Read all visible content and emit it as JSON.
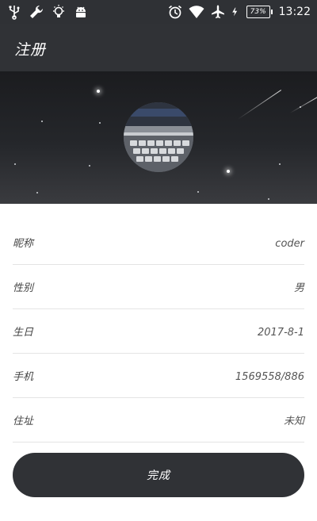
{
  "status_bar": {
    "icons_left": [
      "usb-icon",
      "wrench-icon",
      "lightbulb-icon",
      "android-icon"
    ],
    "icons_right": [
      "alarm-icon",
      "wifi-icon",
      "airplane-icon",
      "charging-icon"
    ],
    "battery": "73%",
    "time": "13:22"
  },
  "header": {
    "title": "注册"
  },
  "form": {
    "rows": [
      {
        "label": "昵称",
        "value": "coder"
      },
      {
        "label": "性别",
        "value": "男"
      },
      {
        "label": "生日",
        "value": "2017-8-1"
      },
      {
        "label": "手机",
        "value": "1569558/886"
      },
      {
        "label": "住址",
        "value": "未知"
      }
    ]
  },
  "actions": {
    "done_label": "完成"
  },
  "colors": {
    "bar": "#303236",
    "divider": "#e4e4e4",
    "button": "#303236"
  }
}
